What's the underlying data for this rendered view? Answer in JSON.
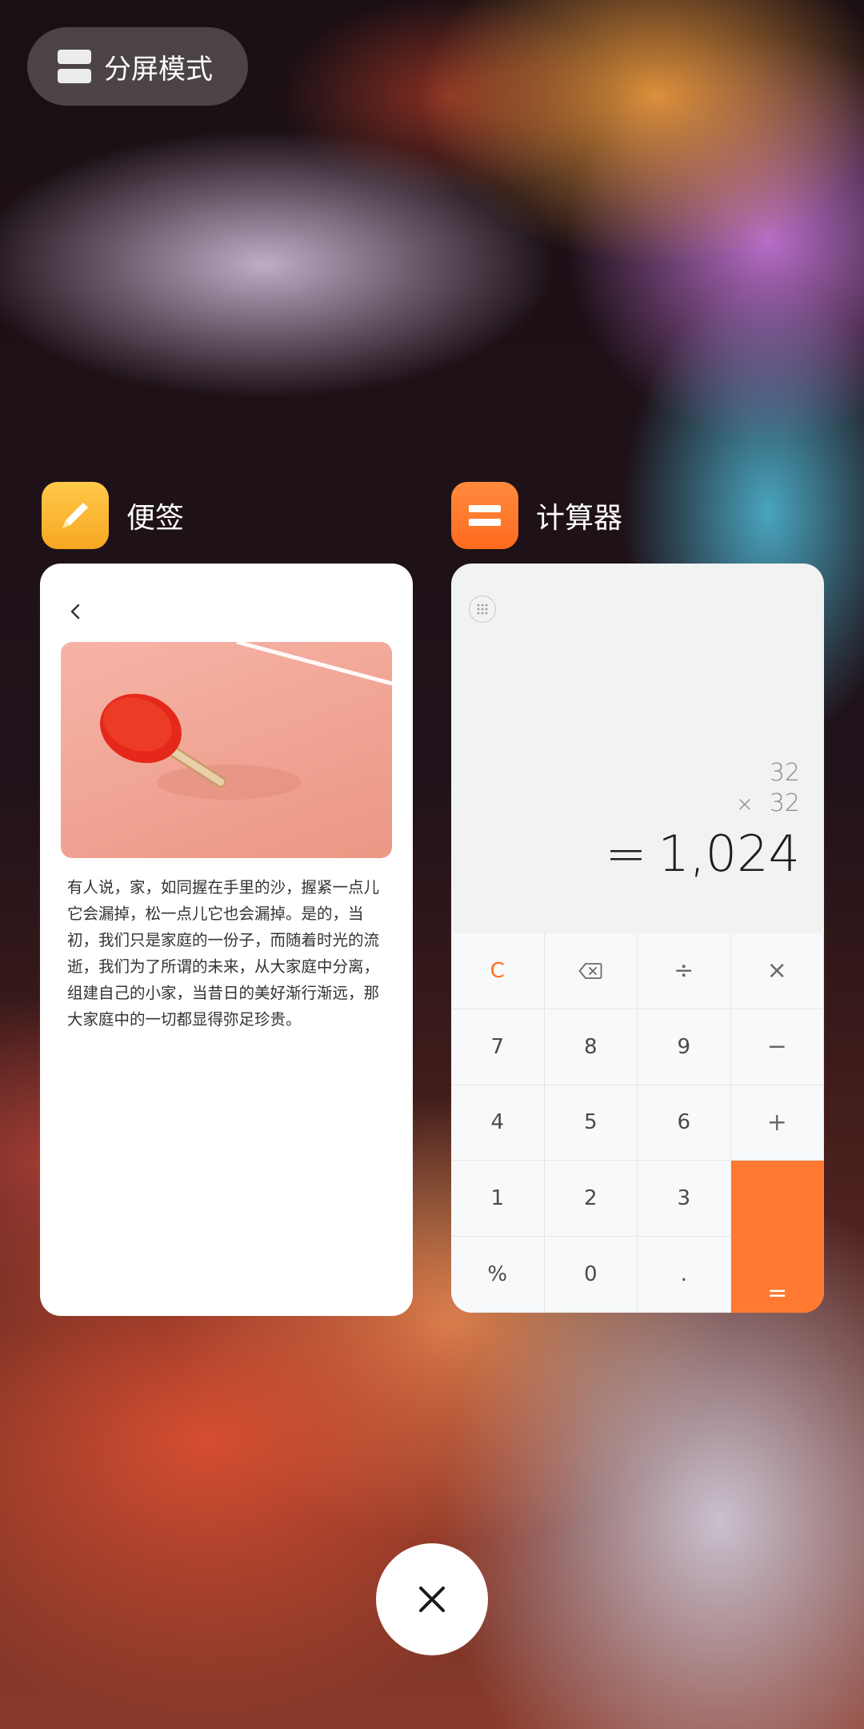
{
  "split_mode": {
    "label": "分屏模式",
    "icon": "split-screen-icon"
  },
  "apps": [
    {
      "name": "便签",
      "icon": "notes-pencil-icon",
      "color": "#F8B12F"
    },
    {
      "name": "计算器",
      "icon": "calculator-icon",
      "color": "#FF7A30"
    }
  ],
  "notes": {
    "back_icon": "chevron-left-icon",
    "image": "ping-pong-paddle-photo",
    "body": "有人说，家，如同握在手里的沙，握紧一点儿它会漏掉，松一点儿它也会漏掉。是的，当初，我们只是家庭的一份子，而随着时光的流逝，我们为了所谓的未来，从大家庭中分离，组建自己的小家，当昔日的美好渐行渐远，那大家庭中的一切都显得弥足珍贵。"
  },
  "calculator": {
    "menu_icon": "grid-menu-icon",
    "operand1": "32",
    "operator": "×",
    "operand2": "32",
    "equals_sign": "=",
    "result": "1,024",
    "keys": {
      "clear": "C",
      "divide": "÷",
      "multiply": "×",
      "k7": "7",
      "k8": "8",
      "k9": "9",
      "minus": "−",
      "k4": "4",
      "k5": "5",
      "k6": "6",
      "plus": "+",
      "k1": "1",
      "k2": "2",
      "k3": "3",
      "percent": "%",
      "k0": "0",
      "dot": ".",
      "equals": "="
    },
    "accent_color": "#FF7A30"
  },
  "close_icon": "close-x-icon"
}
